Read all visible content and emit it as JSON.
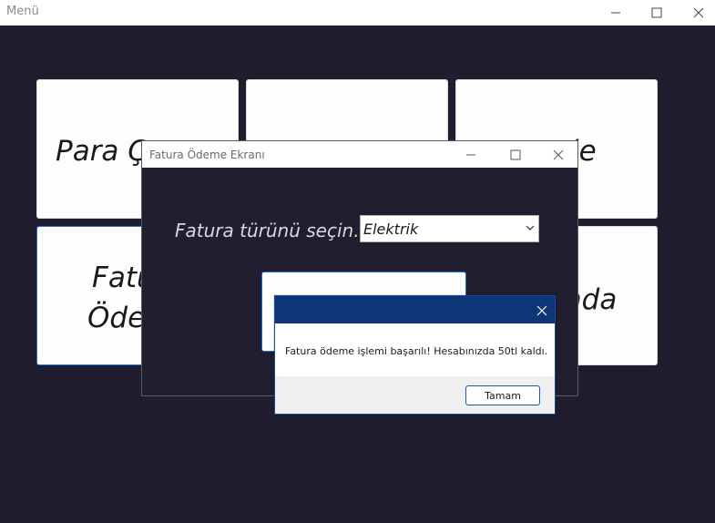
{
  "main_window": {
    "title": "Menü",
    "tiles": [
      {
        "label": "Para Ç"
      },
      {
        "label": ""
      },
      {
        "label": "le"
      },
      {
        "label_line1": "Fatu",
        "label_line2": "Öde"
      },
      {
        "label": "nda"
      }
    ]
  },
  "fatura_window": {
    "title": "Fatura Ödeme Ekranı",
    "prompt_label": "Fatura türünü seçin.",
    "type_select": {
      "selected": "Elektrik"
    }
  },
  "message_box": {
    "message": "Fatura ödeme işlemi başarılı! Hesabınızda 50tl kaldı.",
    "ok_label": "Tamam"
  }
}
